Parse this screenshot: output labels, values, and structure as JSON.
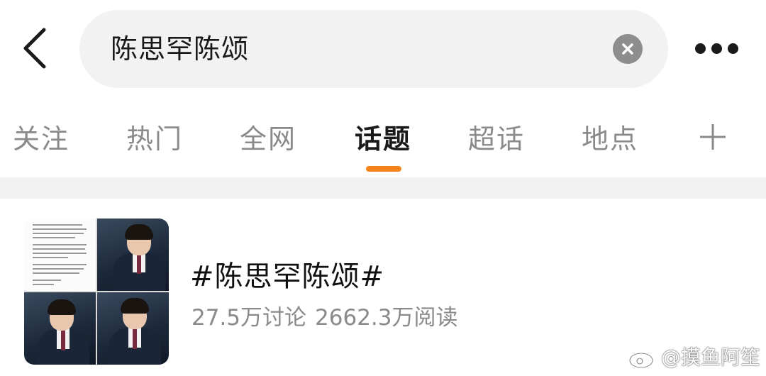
{
  "search": {
    "query": "陈思罕陈颂",
    "icons": {
      "back": "chevron-left-icon",
      "clear": "close-circle-icon",
      "more": "more-horizontal-icon"
    }
  },
  "tabs": {
    "items": [
      {
        "label": "关注"
      },
      {
        "label": "热门"
      },
      {
        "label": "全网"
      },
      {
        "label": "话题",
        "active": true
      },
      {
        "label": "超话"
      },
      {
        "label": "地点"
      }
    ],
    "add_icon": "plus-icon"
  },
  "result": {
    "title": "#陈思罕陈颂#",
    "discussions": "27.5万讨论",
    "reads": "2662.3万阅读",
    "thumbnail": "collage-icon"
  },
  "watermark": {
    "text": "@摸鱼阿笙",
    "icon": "weibo-eye-icon"
  },
  "colors": {
    "accent": "#f5841f",
    "search_bg": "#f2f2f2",
    "muted_text": "#8a8a8a"
  }
}
